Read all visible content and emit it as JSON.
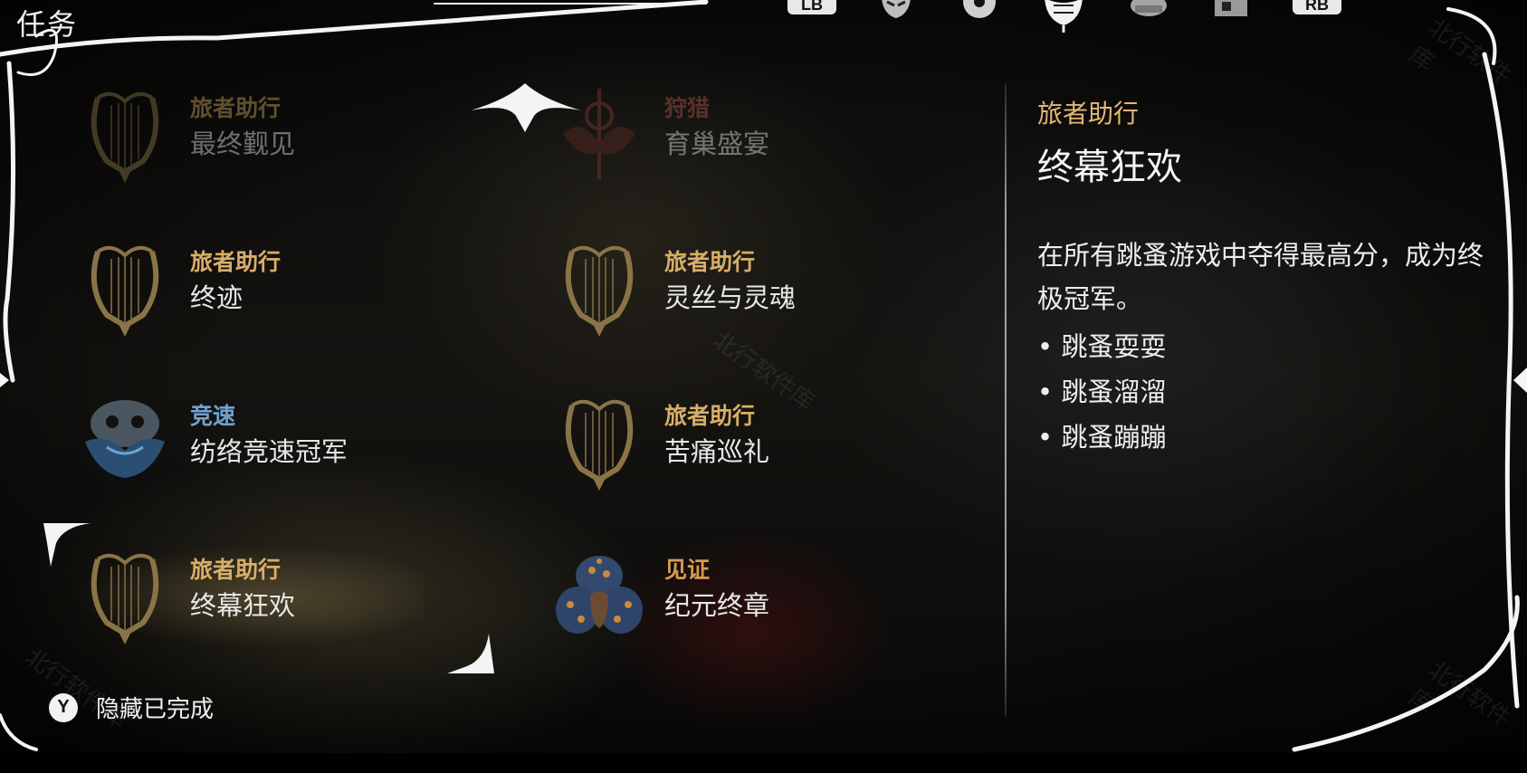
{
  "header": {
    "title": "任务",
    "lb_label": "LB",
    "rb_label": "RB",
    "tabs": [
      {
        "icon": "mask-tab-icon"
      },
      {
        "icon": "pin-tab-icon"
      },
      {
        "icon": "quest-tab-icon",
        "selected": true
      },
      {
        "icon": "cauldron-tab-icon"
      },
      {
        "icon": "map-tab-icon"
      }
    ]
  },
  "quests": [
    {
      "category": "旅者助行",
      "name": "最终觐见",
      "cat_color": "#c9a25e",
      "icon": "lyre-icon",
      "dim": true
    },
    {
      "category": "狩猎",
      "name": "育巢盛宴",
      "cat_color": "#b4524a",
      "icon": "hunt-crest-icon",
      "dim": true
    },
    {
      "category": "旅者助行",
      "name": "终迹",
      "cat_color": "#d9ae68",
      "icon": "lyre-icon",
      "dim": false
    },
    {
      "category": "旅者助行",
      "name": "灵丝与灵魂",
      "cat_color": "#d9ae68",
      "icon": "lyre-icon",
      "dim": false
    },
    {
      "category": "竞速",
      "name": "纺络竞速冠军",
      "cat_color": "#6fa3cf",
      "icon": "racer-mask-icon",
      "dim": false
    },
    {
      "category": "旅者助行",
      "name": "苦痛巡礼",
      "cat_color": "#d9ae68",
      "icon": "lyre-icon",
      "dim": false
    },
    {
      "category": "旅者助行",
      "name": "终幕狂欢",
      "cat_color": "#d9ae68",
      "icon": "lyre-icon",
      "dim": false,
      "selected": true
    },
    {
      "category": "见证",
      "name": "纪元终章",
      "cat_color": "#d89a4e",
      "icon": "witness-spore-icon",
      "dim": false
    }
  ],
  "detail": {
    "category": "旅者助行",
    "title": "终幕狂欢",
    "description": "在所有跳蚤游戏中夺得最高分，成为终极冠军。",
    "bullets": [
      "• 跳蚤耍耍",
      "• 跳蚤溜溜",
      "• 跳蚤蹦蹦"
    ]
  },
  "footer": {
    "button": "Y",
    "label": "隐藏已完成"
  },
  "watermark": "北行软件库"
}
